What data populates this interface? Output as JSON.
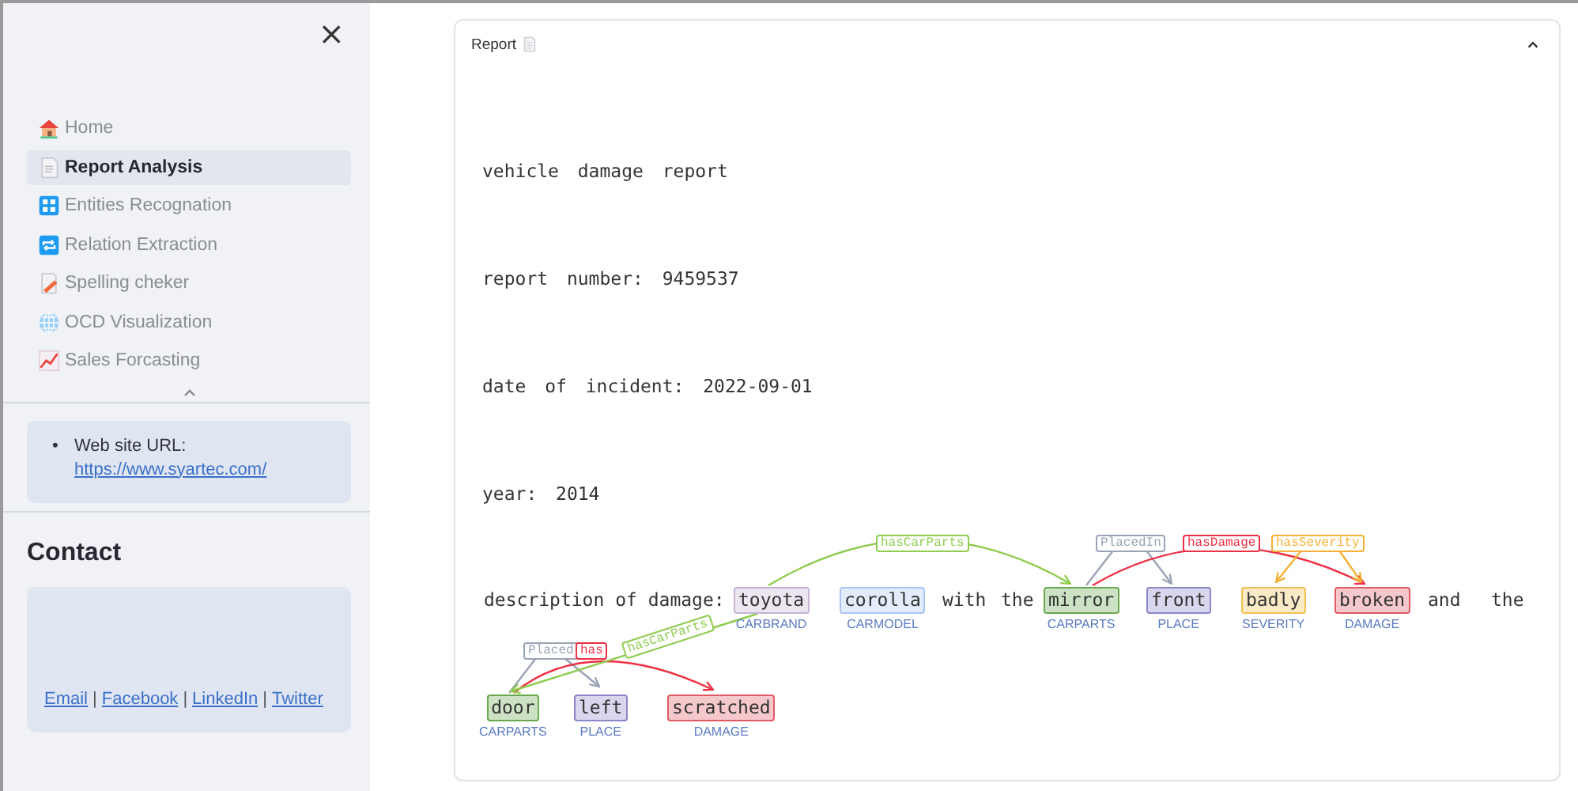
{
  "sidebar": {
    "close": "×",
    "nav": [
      {
        "label": "Home",
        "selected": false
      },
      {
        "label": "Report Analysis",
        "selected": true
      },
      {
        "label": "Entities Recognation",
        "selected": false
      },
      {
        "label": "Relation Extraction",
        "selected": false
      },
      {
        "label": "Spelling cheker",
        "selected": false
      },
      {
        "label": "OCD Visualization",
        "selected": false
      },
      {
        "label": "Sales Forcasting",
        "selected": false
      }
    ],
    "info": {
      "bullet": "•",
      "label": "Web site URL:",
      "link": "https://www.syartec.com/"
    },
    "contact": {
      "title": "Contact",
      "items": [
        {
          "kind": "link",
          "text": "Email"
        },
        {
          "kind": "separator",
          "text": "|"
        },
        {
          "kind": "link",
          "text": "Facebook"
        },
        {
          "kind": "separator",
          "text": "|"
        },
        {
          "kind": "link",
          "text": "LinkedIn"
        },
        {
          "kind": "separator",
          "text": "|"
        },
        {
          "kind": "link",
          "text": "Twitter"
        }
      ]
    }
  },
  "report": {
    "title": "Report",
    "expanded": true,
    "lines": [
      "vehicle damage report",
      "report number: 9459537",
      "date of incident: 2022-09-01",
      "year: 2014"
    ],
    "tokens": [
      {
        "kind": "plain",
        "text": "description of damage:"
      },
      {
        "kind": "entity",
        "text": "toyota",
        "label": "CARBRAND",
        "color": "#c7b3d6"
      },
      {
        "kind": "entity",
        "text": "corolla",
        "label": "CARMODEL",
        "color": "#a9c6ef"
      },
      {
        "kind": "plain",
        "text": "with"
      },
      {
        "kind": "plain",
        "text": "the"
      },
      {
        "kind": "entity",
        "text": "mirror",
        "label": "CARPARTS",
        "color": "#6aa84f"
      },
      {
        "kind": "entity",
        "text": "front",
        "label": "PLACE",
        "color": "#8b86c9"
      },
      {
        "kind": "entity",
        "text": "badly",
        "label": "SEVERITY",
        "color": "#f0c050"
      },
      {
        "kind": "entity",
        "text": "broken",
        "label": "DAMAGE",
        "color": "#e05a66"
      },
      {
        "kind": "plain",
        "text": "and"
      },
      {
        "kind": "plain",
        "text": "the"
      },
      {
        "kind": "entity",
        "text": "door",
        "label": "CARPARTS",
        "color": "#6aa84f"
      },
      {
        "kind": "entity",
        "text": "left",
        "label": "PLACE",
        "color": "#8b86c9"
      },
      {
        "kind": "entity",
        "text": "scratched",
        "label": "DAMAGE",
        "color": "#e05a66"
      }
    ],
    "relations": [
      {
        "label": "hasCarParts",
        "color": "#8fcc4f"
      },
      {
        "label": "PlacedIn",
        "color": "#9aa3b5"
      },
      {
        "label": "hasDamage",
        "color": "#ee3045"
      },
      {
        "label": "hasSeverity",
        "color": "#f5b035"
      },
      {
        "label": "Placed",
        "color": "#9aa3b5"
      },
      {
        "label": "has",
        "color": "#ee3045"
      },
      {
        "label": "hasCarParts",
        "color": "#8fcc4f"
      }
    ]
  }
}
